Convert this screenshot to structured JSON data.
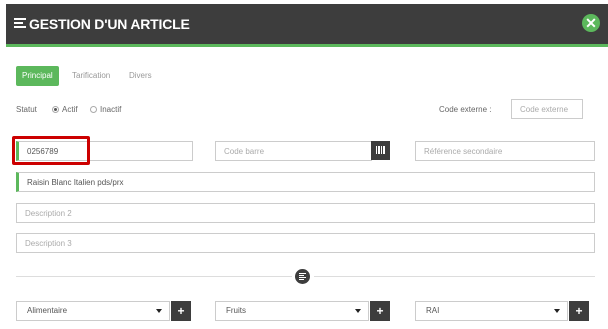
{
  "dialog": {
    "title": "GESTION D'UN ARTICLE"
  },
  "tabs": [
    {
      "label": "Principal",
      "active": true
    },
    {
      "label": "Tarification",
      "active": false
    },
    {
      "label": "Divers",
      "active": false
    }
  ],
  "statut": {
    "label": "Statut",
    "options": [
      {
        "label": "Actif",
        "selected": true
      },
      {
        "label": "Inactif",
        "selected": false
      }
    ]
  },
  "code_externe": {
    "label": "Code externe :",
    "placeholder": "Code externe",
    "value": ""
  },
  "code": {
    "value": "0256789"
  },
  "code_barre": {
    "placeholder": "Code barre",
    "value": ""
  },
  "reference_secondaire": {
    "placeholder": "Référence secondaire",
    "value": ""
  },
  "description1": {
    "value": "Raisin Blanc Italien pds/prx"
  },
  "description2": {
    "placeholder": "Description 2",
    "value": ""
  },
  "description3": {
    "placeholder": "Description 3",
    "value": ""
  },
  "selects": [
    {
      "value": "Alimentaire"
    },
    {
      "value": "Fruits"
    },
    {
      "value": "RAI"
    }
  ],
  "colors": {
    "header": "#3d3d3d",
    "accent": "#5cb85c",
    "highlight": "#cc0000"
  },
  "icons": {
    "title": "list-icon",
    "close": "close-circle-icon",
    "barcode": "barcode-icon",
    "details": "align-left-circle-icon",
    "add": "plus-icon",
    "dropdown": "caret-down-icon"
  }
}
